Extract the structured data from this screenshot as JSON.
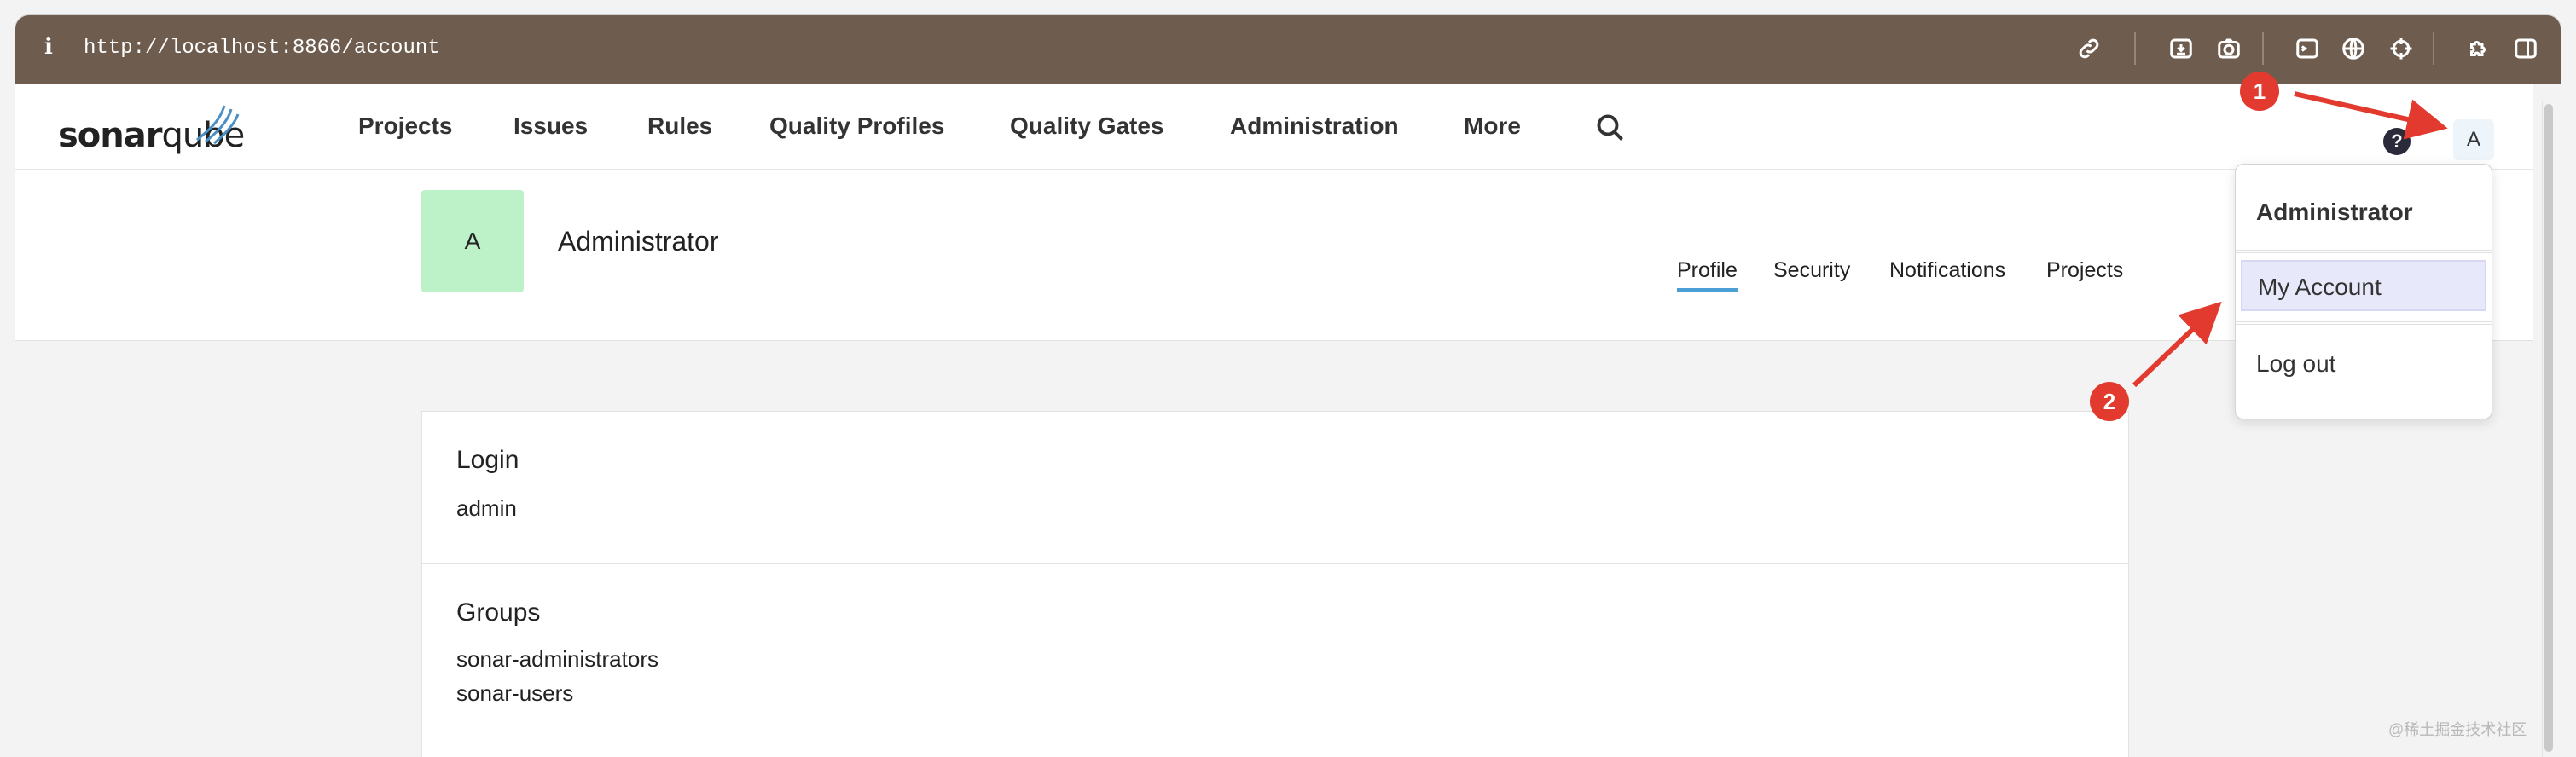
{
  "browser": {
    "url": "http://localhost:8866/account",
    "info_glyph": "i",
    "toolbar_icons": [
      "link-icon",
      "download-icon",
      "camera-icon",
      "terminal-icon",
      "globe-icon",
      "crosshair-icon",
      "extension-icon",
      "sidebar-icon"
    ]
  },
  "nav": {
    "logo_text_bold": "sonar",
    "logo_text_light": "qube",
    "items": [
      "Projects",
      "Issues",
      "Rules",
      "Quality Profiles",
      "Quality Gates",
      "Administration",
      "More"
    ],
    "help_glyph": "?",
    "avatar_letter": "A"
  },
  "account": {
    "avatar_letter": "A",
    "name": "Administrator",
    "tabs": [
      "Profile",
      "Security",
      "Notifications",
      "Projects"
    ],
    "active_tab": "Profile"
  },
  "profile": {
    "login_title": "Login",
    "login_value": "admin",
    "groups_title": "Groups",
    "groups": [
      "sonar-administrators",
      "sonar-users"
    ]
  },
  "dropdown": {
    "name": "Administrator",
    "items": [
      "My Account",
      "Log out"
    ]
  },
  "annotations": {
    "badge_1": "1",
    "badge_2": "2",
    "color": "#e23a2e"
  },
  "watermark": "@稀土掘金技术社区"
}
